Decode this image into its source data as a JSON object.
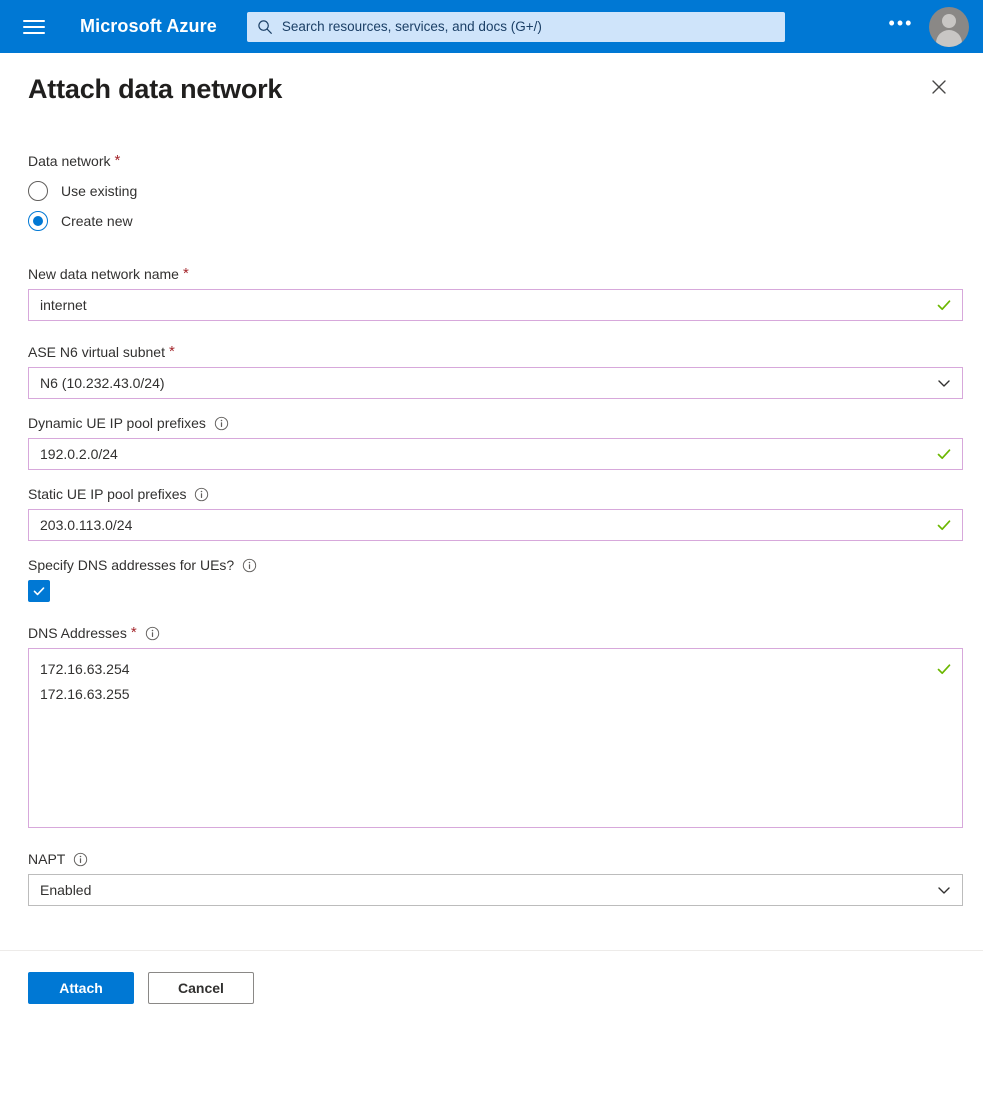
{
  "topbar": {
    "menu_icon": "hamburger-icon",
    "brand": "Microsoft Azure",
    "search": {
      "icon": "search-icon",
      "placeholder": "Search resources, services, and docs (G+/)",
      "value": ""
    },
    "more_label": "•••",
    "avatar_icon": "account-avatar-icon",
    "bar_color": "#0078d4",
    "search_bg": "#cfe4fa"
  },
  "blade": {
    "title": "Attach data network",
    "close_icon": "close-icon"
  },
  "form": {
    "data_network": {
      "label": "Data network",
      "required": true,
      "options": [
        {
          "label": "Use existing",
          "selected": false
        },
        {
          "label": "Create new",
          "selected": true
        }
      ]
    },
    "new_data_network_name": {
      "label": "New data network name",
      "required": true,
      "value": "internet",
      "valid": true,
      "validation_icon": "checkmark-icon"
    },
    "ase_n6_virtual_subnet": {
      "label": "ASE N6 virtual subnet",
      "required": true,
      "value": "N6 (10.232.43.0/24)",
      "chevron_icon": "chevron-down-icon"
    },
    "dynamic_ue_ip_pool_prefixes": {
      "label": "Dynamic UE IP pool prefixes",
      "required": false,
      "info_icon": "info-icon",
      "value": "192.0.2.0/24",
      "valid": true,
      "validation_icon": "checkmark-icon"
    },
    "static_ue_ip_pool_prefixes": {
      "label": "Static UE IP pool prefixes",
      "required": false,
      "info_icon": "info-icon",
      "value": "203.0.113.0/24",
      "valid": true,
      "validation_icon": "checkmark-icon"
    },
    "specify_dns": {
      "label": "Specify DNS addresses for UEs?",
      "info_icon": "info-icon",
      "checked": true,
      "check_icon": "checkmark-icon"
    },
    "dns_addresses": {
      "label": "DNS Addresses",
      "required": true,
      "info_icon": "info-icon",
      "lines": [
        "172.16.63.254",
        "172.16.63.255"
      ],
      "valid": true,
      "validation_icon": "checkmark-icon"
    },
    "napt": {
      "label": "NAPT",
      "required": false,
      "info_icon": "info-icon",
      "value": "Enabled",
      "chevron_icon": "chevron-down-icon"
    }
  },
  "footer": {
    "attach_label": "Attach",
    "cancel_label": "Cancel"
  },
  "colors": {
    "azure_blue": "#0078d4",
    "required_asterisk": "#a4262c",
    "validated_border": "#d7a8db",
    "success_green": "#6bb700",
    "neutral_border": "#bcbcbc"
  }
}
